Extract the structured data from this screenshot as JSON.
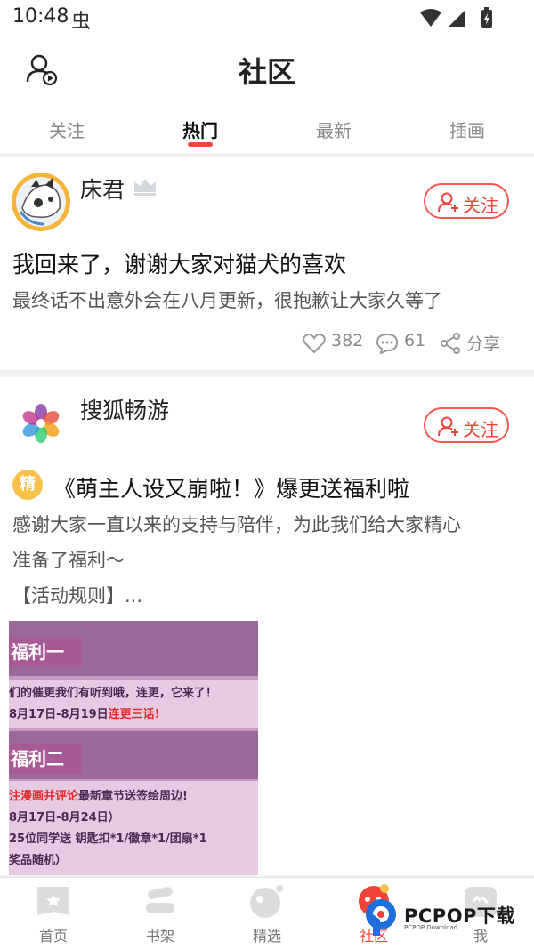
{
  "status_bar": {
    "time": "10:48",
    "bug_glyph": "虫"
  },
  "header": {
    "title": "社区",
    "left_icon": "user-play-icon"
  },
  "tabs": [
    {
      "label": "关注",
      "active": false
    },
    {
      "label": "热门",
      "active": true
    },
    {
      "label": "最新",
      "active": false
    },
    {
      "label": "插画",
      "active": false
    }
  ],
  "posts": [
    {
      "author": "床君",
      "follow_label": "关注",
      "title": "我回来了，谢谢大家对猫犬的喜欢",
      "subtitle": "最终话不出意外会在八月更新，很抱歉让大家久等了",
      "likes": "382",
      "comments": "61",
      "share_label": "分享"
    },
    {
      "author": "搜狐畅游",
      "follow_label": "关注",
      "badge": "精",
      "title": "《萌主人设又崩啦！》爆更送福利啦",
      "body_line1": "感谢大家一直以来的支持与陪伴，为此我们给大家精心",
      "body_line2": "准备了福利～",
      "body_line3": "【活动规则】...",
      "image_text": {
        "header1": "福利一",
        "line1": "们的催更我们有听到哦，连更，它来了！",
        "line2a": "8月17日-8月19日",
        "line2b": "连更三话!",
        "header2": "福利二",
        "line3a": "注漫画并评论",
        "line3b": "最新章节送签绘周边!",
        "line4": "8月17日-8月24日）",
        "line5": "25位同学送 钥匙扣*1/徽章*1/团扇*1",
        "line6": "奖品随机）"
      }
    }
  ],
  "bottom_nav": [
    {
      "label": "首页",
      "active": false
    },
    {
      "label": "书架",
      "active": false
    },
    {
      "label": "精选",
      "active": false
    },
    {
      "label": "社区",
      "active": true
    },
    {
      "label": "我",
      "active": false
    }
  ],
  "watermark": {
    "text": "PCPOP下载",
    "sub": "PCPOP Download"
  },
  "colors": {
    "accent": "#f0443b",
    "badge": "#f8c24a"
  }
}
